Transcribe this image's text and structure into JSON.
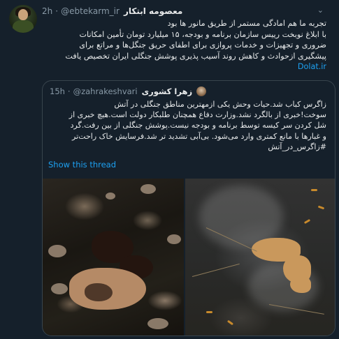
{
  "tweet": {
    "display_name": "معصومه ابتکار",
    "handle": "@ebtekarm_ir",
    "separator": "·",
    "time": "2h",
    "text": "تجربه ما هم امادگی مستمر از طریق مانور ها بود\nبا ابلاغ نوبخت رییس سازمان برنامه و بودجه، ۱۵ میلیارد تومان تأمین امکانات\nضروری و تجهیزات و خدمات پروازی برای اطفای حریق جنگل‌ها و مراتع برای\nپیشگیری ازحوادث و کاهش روند آسیب پذیری پوشش جنگلی ایران تخصیص یافت",
    "link_text": "Dolat.ir"
  },
  "quoted": {
    "display_name": "زهرا کشوری",
    "handle": "@zahrakeshvari",
    "separator": "·",
    "time": "15h",
    "text": "زاگرس کباب شد.حیات وحش یکی ازمهترین مناطق جنگلی در آتش\nسوخت!خبری از بالگرد نشد.وزارت دفاع همچنان طلبکار دولت است.هیچ خبری از\nشل کردن سر کیسه توسط برنامه و بودجه نیست.پوشش جنگلی از بین رفت.گرد\nو غبارها با مانع کمتری وارد می‌شود. بی‌آبی تشدید تر شد.فرسایش خاک راحت‌تر\n#زاگرس_در_آتش",
    "show_thread": "Show this thread"
  },
  "icons": {
    "avatar": "user-avatar",
    "menu": "chevron-down-icon"
  },
  "colors": {
    "background": "#15202b",
    "link": "#1da1f2",
    "muted": "#8899a6",
    "border": "#38444d"
  }
}
